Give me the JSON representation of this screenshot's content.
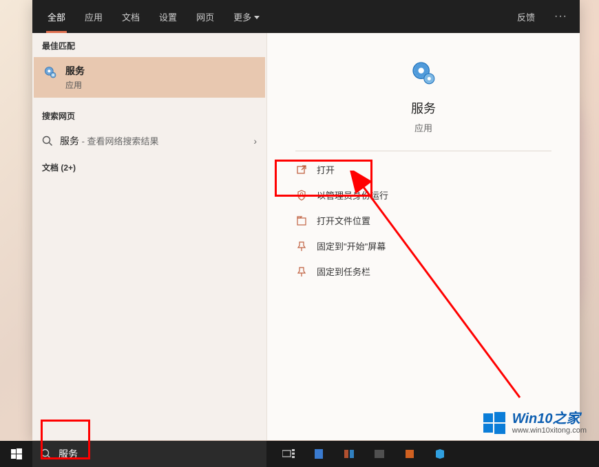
{
  "tabs": {
    "items": [
      "全部",
      "应用",
      "文档",
      "设置",
      "网页",
      "更多"
    ],
    "feedback": "反馈"
  },
  "left": {
    "best_match_label": "最佳匹配",
    "best_match": {
      "title": "服务",
      "subtitle": "应用"
    },
    "web_label": "搜索网页",
    "web_item": {
      "query": "服务",
      "hint": " - 查看网络搜索结果"
    },
    "docs_label": "文档 (2+)"
  },
  "right": {
    "title": "服务",
    "type": "应用",
    "actions": [
      "打开",
      "以管理员身份运行",
      "打开文件位置",
      "固定到\"开始\"屏幕",
      "固定到任务栏"
    ]
  },
  "taskbar": {
    "search_value": "服务"
  },
  "watermark": {
    "title": "Win10之家",
    "url": "www.win10xitong.com"
  }
}
